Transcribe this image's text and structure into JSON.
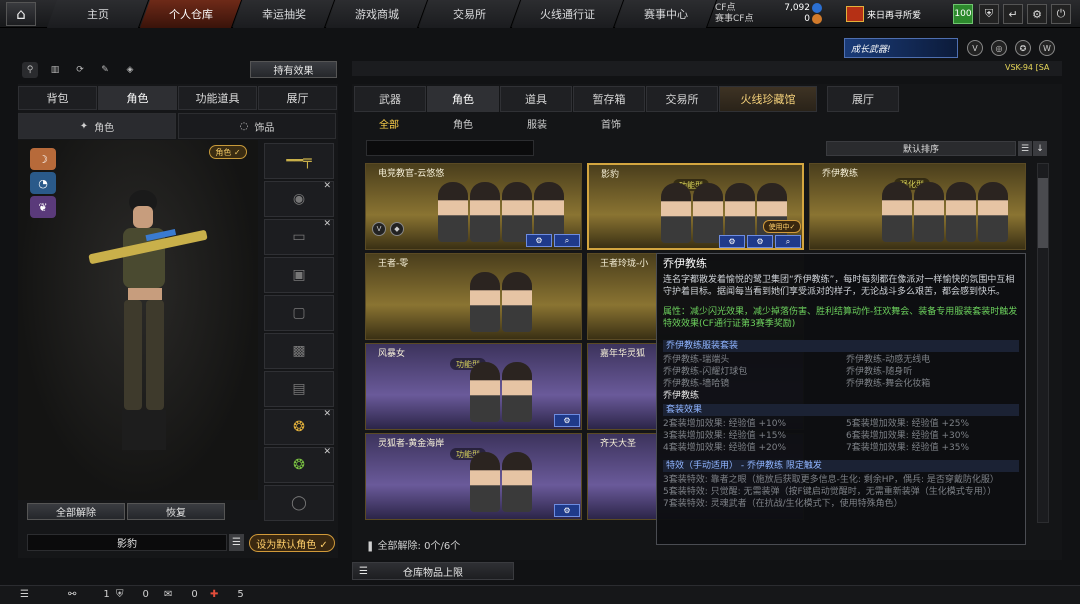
{
  "nav": {
    "tabs": [
      {
        "label": "主页"
      },
      {
        "label": "个人仓库"
      },
      {
        "label": "幸运抽奖"
      },
      {
        "label": "游戏商城"
      },
      {
        "label": "交易所"
      },
      {
        "label": "火线通行证"
      },
      {
        "label": "赛事中心"
      }
    ],
    "active_tab": "个人仓库",
    "cf_label": "CF点",
    "cf_value": "7,092",
    "match_cf_label": "赛事CF点",
    "match_cf_value": "0",
    "username": "来日再寻所爱",
    "level": "100"
  },
  "left": {
    "effects_button": "持有效果",
    "tabs": [
      {
        "label": "背包"
      },
      {
        "label": "角色"
      },
      {
        "label": "功能道具"
      },
      {
        "label": "展厅"
      }
    ],
    "subtabs": [
      {
        "label": "角色"
      },
      {
        "label": "饰品"
      }
    ],
    "role_badge": "角色 ✓",
    "release_all": "全部解除",
    "restore": "恢复",
    "character_name": "影豹",
    "set_default": "设为默认角色 ✓"
  },
  "right": {
    "banner": "成长武器!",
    "weapon_text": "VSK-94  [SA",
    "tabs": [
      {
        "label": "武器"
      },
      {
        "label": "角色"
      },
      {
        "label": "道具"
      },
      {
        "label": "暂存箱"
      },
      {
        "label": "交易所"
      },
      {
        "label": "火线珍藏馆"
      },
      {
        "label": "展厅"
      }
    ],
    "subtabs": [
      {
        "label": "全部"
      },
      {
        "label": "角色"
      },
      {
        "label": "服装"
      },
      {
        "label": "首饰"
      }
    ],
    "sort_label": "默认排序",
    "cards": [
      {
        "title": "电竞教官-云悠悠",
        "tag": ""
      },
      {
        "title": "影豹",
        "tag": "功能型",
        "in_use": "使用中✓"
      },
      {
        "title": "乔伊教练",
        "tag": "强化型"
      },
      {
        "title": "王者-零",
        "tag": ""
      },
      {
        "title": "王者玲珑-小",
        "tag": ""
      },
      {
        "title": "风暴女",
        "tag": "功能型"
      },
      {
        "title": "嘉年华灵狐",
        "tag": ""
      },
      {
        "title": "灵狐者-黄金海岸",
        "tag": "功能型"
      },
      {
        "title": "齐天大圣",
        "tag": ""
      }
    ],
    "release_status": "全部解除: 0个/6个",
    "storage_label": "仓库物品上限"
  },
  "tooltip": {
    "title": "乔伊教练",
    "description": "连名字都散发着愉悦的鹭卫集团“乔伊教练”，每时每刻都在像派对一样愉快的氛围中互相守护着目标。据闻每当看到她们享受派对的样子，无论战斗多么艰苦，都会感到快乐。",
    "attribute": "属性：减少闪光效果，减少掉落伤害、胜利结算动作-狂欢舞会、装备专用服装套装时触发特效效果(CF通行证第3赛季奖励)",
    "set_title": "乔伊教练服装套装",
    "set_items": [
      "乔伊教练-瑞端头",
      "乔伊教练-动感无线电",
      "乔伊教练-闪耀灯球包",
      "乔伊教练-随身听",
      "乔伊教练-墙哈镜",
      "乔伊教练-舞会化妆箱"
    ],
    "set_current": "乔伊教练",
    "effect_title": "套装效果",
    "effects": [
      "2套装增加效果: 经验值 +10%",
      "5套装增加效果: 经验值 +25%",
      "3套装增加效果: 经验值 +15%",
      "6套装增加效果: 经验值 +30%",
      "4套装增加效果: 经验值 +20%",
      "7套装增加效果: 经验值 +35%"
    ],
    "special_title": "特效（手动适用） - 乔伊教练 限定触发",
    "special": [
      "3套装特效:      靠者之眼（施放后获取更多信息-生化: 剩余HP，偶兵: 是否穿戴防化服）",
      "5套装特效:      只觉醒: 无需装弹（按F键启动觉醒时，无需重新装弹（生化模式专用））",
      "7套装特效:      灵魂武者（在抗战/生化模式下，使用特殊角色）"
    ]
  },
  "status": {
    "messages": "1",
    "friends": "0",
    "chat": "0",
    "gifts": "5"
  },
  "colors": {
    "accent": "#d4a640",
    "active_nav": "#6e2a18",
    "tooltip_green": "#6cd15d"
  }
}
